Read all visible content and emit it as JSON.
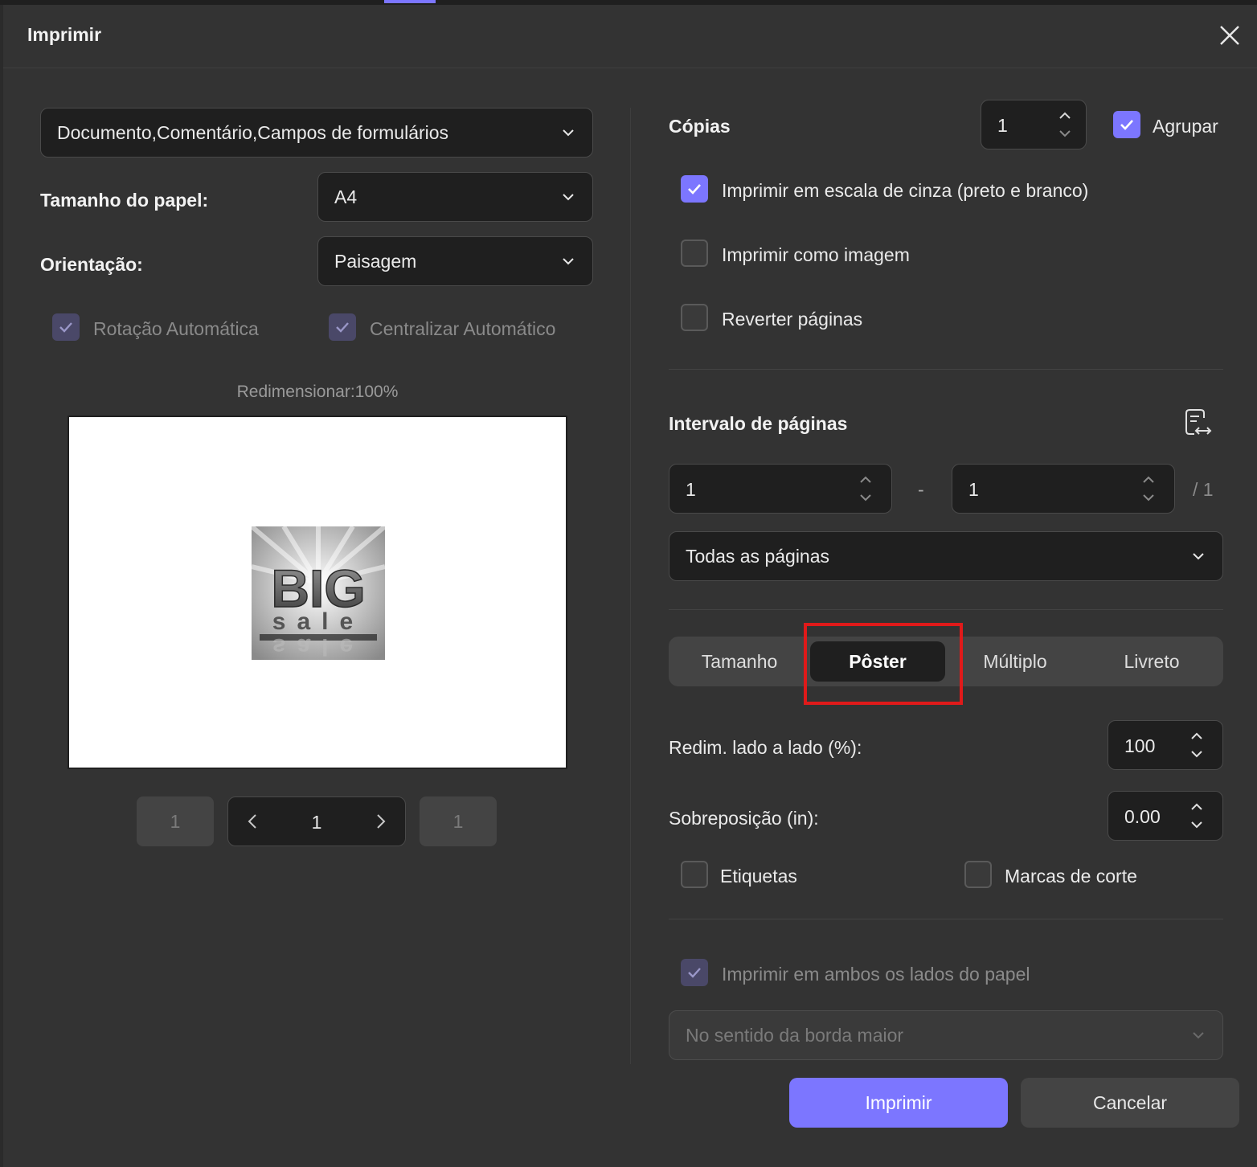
{
  "dialog": {
    "title": "Imprimir"
  },
  "left": {
    "content_select": "Documento,Comentário,Campos de formulários",
    "paper_size_label": "Tamanho do papel:",
    "paper_size_value": "A4",
    "orientation_label": "Orientação:",
    "orientation_value": "Paisagem",
    "auto_rotate_label": "Rotação Automática",
    "auto_center_label": "Centralizar Automático",
    "resize_label": "Redimensionar:100%",
    "preview_image": {
      "big": "BIG",
      "small": "sale"
    },
    "pager": {
      "first": "1",
      "current": "1",
      "last": "1"
    }
  },
  "right": {
    "copies_label": "Cópias",
    "copies_value": "1",
    "collate_label": "Agrupar",
    "grayscale_label": "Imprimir em escala de cinza (preto e branco)",
    "as_image_label": "Imprimir como imagem",
    "reverse_label": "Reverter páginas",
    "page_range_label": "Intervalo de páginas",
    "range_from": "1",
    "range_sep": "-",
    "range_to": "1",
    "range_total": "/ 1",
    "pages_select": "Todas as páginas",
    "tabs": [
      "Tamanho",
      "Pôster",
      "Múltiplo",
      "Livreto"
    ],
    "active_tab": "Pôster",
    "tile_scale_label": "Redim. lado a lado (%):",
    "tile_scale_value": "100",
    "overlap_label": "Sobreposição (in):",
    "overlap_value": "0.00",
    "labels_label": "Etiquetas",
    "cut_marks_label": "Marcas de corte",
    "duplex_label": "Imprimir em ambos os lados do papel",
    "duplex_select": "No sentido da borda maior",
    "print_button": "Imprimir",
    "cancel_button": "Cancelar"
  },
  "colors": {
    "accent": "#7c76ff",
    "highlight": "#e01a1a",
    "background": "#333333"
  }
}
